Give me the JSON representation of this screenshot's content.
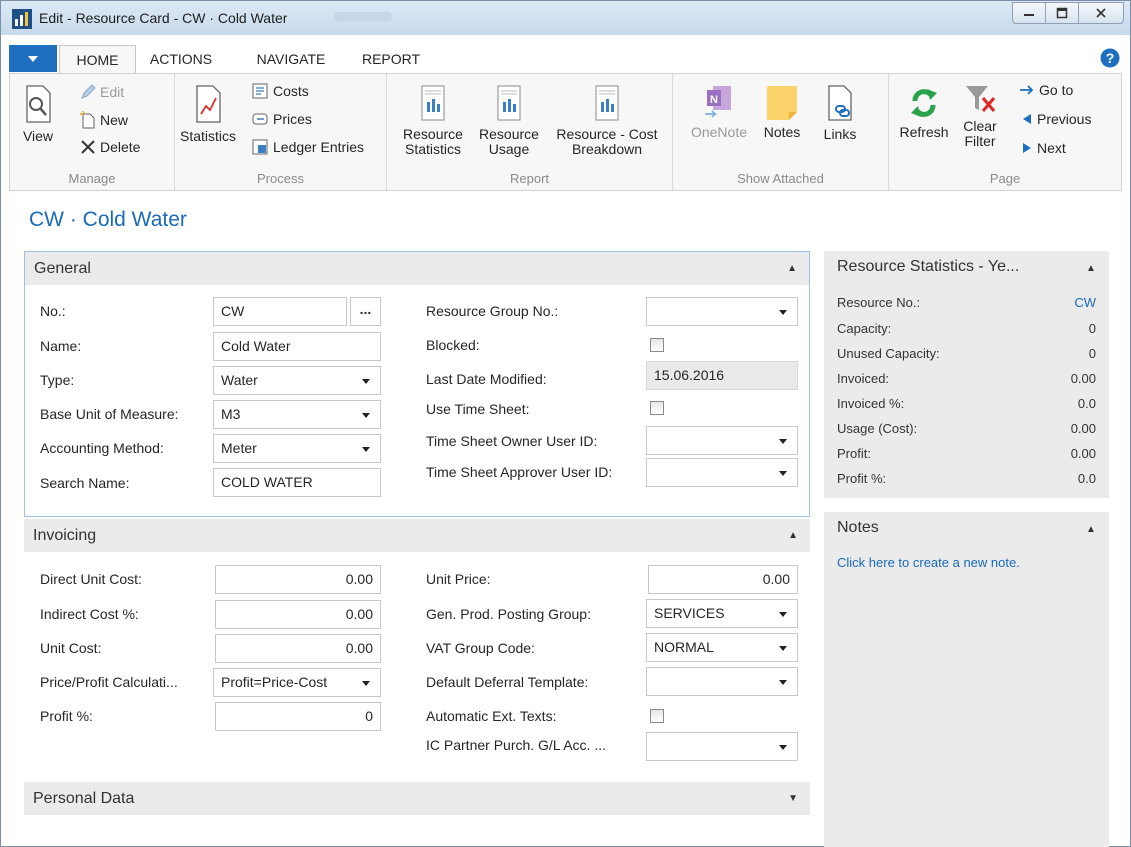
{
  "window": {
    "title": "Edit - Resource Card - CW · Cold Water"
  },
  "tabs": [
    {
      "label": "HOME"
    },
    {
      "label": "ACTIONS"
    },
    {
      "label": "NAVIGATE"
    },
    {
      "label": "REPORT"
    }
  ],
  "ribbon": {
    "manage": {
      "label": "Manage",
      "view": "View",
      "edit": "Edit",
      "new": "New",
      "delete": "Delete"
    },
    "process": {
      "label": "Process",
      "statistics": "Statistics",
      "costs": "Costs",
      "prices": "Prices",
      "ledger_entries": "Ledger Entries"
    },
    "report": {
      "label": "Report",
      "resource_statistics_1": "Resource",
      "resource_statistics_2": "Statistics",
      "resource_usage_1": "Resource",
      "resource_usage_2": "Usage",
      "cost_breakdown_1": "Resource - Cost",
      "cost_breakdown_2": "Breakdown"
    },
    "show_attached": {
      "label": "Show Attached",
      "onenote": "OneNote",
      "notes": "Notes",
      "links": "Links"
    },
    "page": {
      "label": "Page",
      "refresh": "Refresh",
      "clear_filter_1": "Clear",
      "clear_filter_2": "Filter",
      "go_to": "Go to",
      "previous": "Previous",
      "next": "Next"
    }
  },
  "page_title": "CW · Cold Water",
  "general": {
    "header": "General",
    "no_label": "No.:",
    "no_value": "CW",
    "no_lookup": "...",
    "name_label": "Name:",
    "name_value": "Cold Water",
    "type_label": "Type:",
    "type_value": "Water",
    "base_uom_label": "Base Unit of Measure:",
    "base_uom_value": "M3",
    "accounting_label": "Accounting Method:",
    "accounting_value": "Meter",
    "search_label": "Search Name:",
    "search_value": "COLD WATER",
    "resource_group_label": "Resource Group No.:",
    "resource_group_value": "",
    "blocked_label": "Blocked:",
    "blocked_checked": false,
    "last_modified_label": "Last Date Modified:",
    "last_modified_value": "15.06.2016",
    "use_timesheet_label": "Use Time Sheet:",
    "use_timesheet_checked": false,
    "ts_owner_label": "Time Sheet Owner User ID:",
    "ts_owner_value": "",
    "ts_approver_label": "Time Sheet Approver User ID:",
    "ts_approver_value": ""
  },
  "invoicing": {
    "header": "Invoicing",
    "direct_cost_label": "Direct Unit Cost:",
    "direct_cost_value": "0.00",
    "indirect_cost_label": "Indirect Cost %:",
    "indirect_cost_value": "0.00",
    "unit_cost_label": "Unit Cost:",
    "unit_cost_value": "0.00",
    "price_profit_label": "Price/Profit Calculati...",
    "price_profit_value": "Profit=Price-Cost",
    "profit_pct_label": "Profit %:",
    "profit_pct_value": "0",
    "unit_price_label": "Unit Price:",
    "unit_price_value": "0.00",
    "gen_prod_label": "Gen. Prod. Posting Group:",
    "gen_prod_value": "SERVICES",
    "vat_group_label": "VAT Group Code:",
    "vat_group_value": "NORMAL",
    "deferral_label": "Default Deferral Template:",
    "deferral_value": "",
    "auto_ext_label": "Automatic Ext. Texts:",
    "auto_ext_checked": false,
    "ic_partner_label": "IC Partner Purch. G/L Acc. ...",
    "ic_partner_value": ""
  },
  "personal_data": {
    "header": "Personal Data"
  },
  "factbox_stats": {
    "title": "Resource Statistics - Ye...",
    "rows": [
      {
        "label": "Resource No.:",
        "value": "CW"
      },
      {
        "label": "Capacity:",
        "value": "0"
      },
      {
        "label": "Unused Capacity:",
        "value": "0"
      },
      {
        "label": "Invoiced:",
        "value": "0.00"
      },
      {
        "label": "Invoiced %:",
        "value": "0.0"
      },
      {
        "label": "Usage (Cost):",
        "value": "0.00"
      },
      {
        "label": "Profit:",
        "value": "0.00"
      },
      {
        "label": "Profit %:",
        "value": "0.0"
      }
    ]
  },
  "factbox_notes": {
    "title": "Notes",
    "link": "Click here to create a new note."
  },
  "colors": {
    "accent": "#1a6bb8",
    "menu_button": "#1e6fc0",
    "header_bg": "#ebebeb"
  }
}
